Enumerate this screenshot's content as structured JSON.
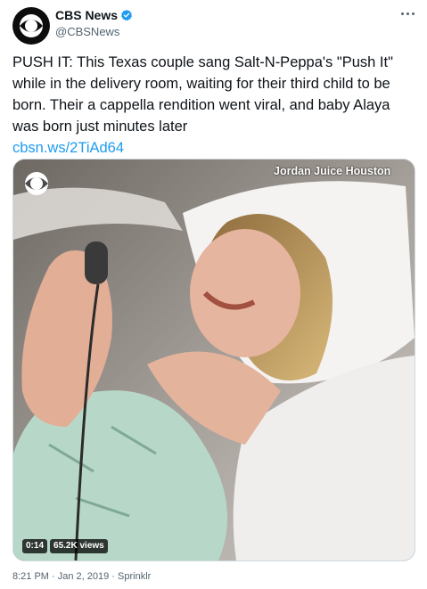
{
  "author": {
    "name": "CBS News",
    "handle": "@CBSNews"
  },
  "tweet": {
    "text": "PUSH IT: This Texas couple sang Salt-N-Peppa's \"Push It\" while in the delivery room, waiting for their third child to be born. Their a cappella rendition went viral, and baby Alaya was born just minutes later",
    "link": "cbsn.ws/2TiAd64"
  },
  "media": {
    "watermark": "Jordan Juice Houston",
    "duration": "0:14",
    "views": "65.2K views"
  },
  "footer": {
    "timestamp": "8:21 PM · Jan 2, 2019 · Sprinklr"
  },
  "colors": {
    "link": "#1d9bf0",
    "verified": "#1d9bf0",
    "secondary_text": "#536471"
  }
}
